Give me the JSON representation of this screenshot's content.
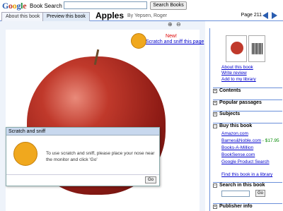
{
  "header": {
    "logo_text": "Google",
    "logo_sub": "Book Search",
    "search_placeholder": "",
    "search_button": "Search Books"
  },
  "tabs": [
    {
      "label": "About this book"
    },
    {
      "label": "Preview this book"
    }
  ],
  "book": {
    "title": "Apples",
    "author": "By Yepsen, Roger"
  },
  "pager": {
    "page_label": "Page 211"
  },
  "scratch_sniff": {
    "badge": "New!",
    "link": "Scratch and sniff this page"
  },
  "dialog": {
    "title": "Scratch and sniff",
    "message": "To use scratch and sniff, please place your nose near the monitor and click 'Go'",
    "go_button": "Go"
  },
  "sidebar": {
    "links": [
      "About this book",
      "Write review",
      "Add to my library"
    ],
    "sections": [
      "Contents",
      "Popular passages",
      "Subjects",
      "Buy this book",
      "Search in this book",
      "Publisher info"
    ],
    "buy_links": [
      {
        "label": "Amazon.com",
        "price": ""
      },
      {
        "label": "Barnes&Noble.com",
        "price": " - $17.95"
      },
      {
        "label": "Books-A-Million",
        "price": ""
      },
      {
        "label": "BookSense.com",
        "price": ""
      },
      {
        "label": "Google Product Search",
        "price": ""
      }
    ],
    "library_link": "Find this book in a library",
    "search_go": "Go"
  },
  "colors": {
    "link": "#0000cc",
    "accent": "#6b90da",
    "price": "#008800"
  }
}
